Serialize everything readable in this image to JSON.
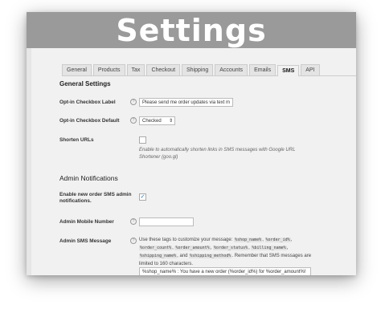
{
  "banner": {
    "title": "Settings"
  },
  "tabs": [
    {
      "label": "General",
      "active": false
    },
    {
      "label": "Products",
      "active": false
    },
    {
      "label": "Tax",
      "active": false
    },
    {
      "label": "Checkout",
      "active": false
    },
    {
      "label": "Shipping",
      "active": false
    },
    {
      "label": "Accounts",
      "active": false
    },
    {
      "label": "Emails",
      "active": false
    },
    {
      "label": "SMS",
      "active": true
    },
    {
      "label": "API",
      "active": false
    }
  ],
  "general": {
    "heading": "General Settings",
    "optin_label": {
      "label": "Opt-in Checkbox Label",
      "value": "Please send me order updates via text m"
    },
    "optin_default": {
      "label": "Opt-in Checkbox Default",
      "value": "Checked"
    },
    "shorten_urls": {
      "label": "Shorten URLs",
      "checked": false,
      "description": "Enable to automatically shorten links in SMS messages with Google URL Shortener (goo.gl)"
    }
  },
  "admin": {
    "heading": "Admin Notifications",
    "enable": {
      "label": "Enable new order SMS admin notifications.",
      "checked": true,
      "check_glyph": "✓"
    },
    "mobile": {
      "label": "Admin Mobile Number",
      "value": ""
    },
    "message": {
      "label": "Admin SMS Message",
      "intro": "Use these tags to customize your message:",
      "tags": [
        "%shop_name%",
        "%order_id%",
        "%order_count%",
        "%order_amount%",
        "%order_status%",
        "%billing_name%",
        "%shipping_name%",
        "%shipping_method%"
      ],
      "outro": ". Remember that SMS messages are limited to 160 characters.",
      "value": "%shop_name% : You have a new order (%order_id%) for %order_amount%!"
    }
  },
  "icons": {
    "help": "help-icon",
    "select_arrow": "chevron-updown-icon"
  },
  "colors": {
    "banner": "#9a9a9a",
    "panel": "#f1f1f1",
    "check": "#2271b1"
  }
}
